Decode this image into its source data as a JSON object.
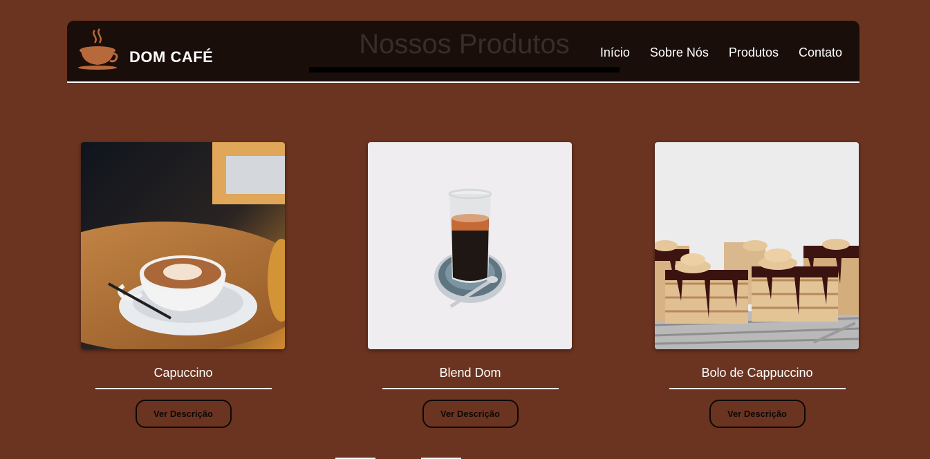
{
  "brand": {
    "name": "DOM CAFÉ"
  },
  "header": {
    "title": "Nossos Produtos"
  },
  "nav": [
    {
      "label": "Início"
    },
    {
      "label": "Sobre Nós"
    },
    {
      "label": "Produtos"
    },
    {
      "label": "Contato"
    }
  ],
  "products": [
    {
      "name": "Capuccino",
      "button": "Ver Descrição",
      "image": "latte-art-cup-photo"
    },
    {
      "name": "Blend Dom",
      "button": "Ver Descrição",
      "image": "espresso-glass-photo"
    },
    {
      "name": "Bolo de Cappuccino",
      "button": "Ver Descrição",
      "image": "cappuccino-cakes-photo"
    }
  ],
  "colors": {
    "background": "#6b3420",
    "header": "#1a0e0b",
    "text": "#ffffff",
    "logo": "#b8693c"
  }
}
